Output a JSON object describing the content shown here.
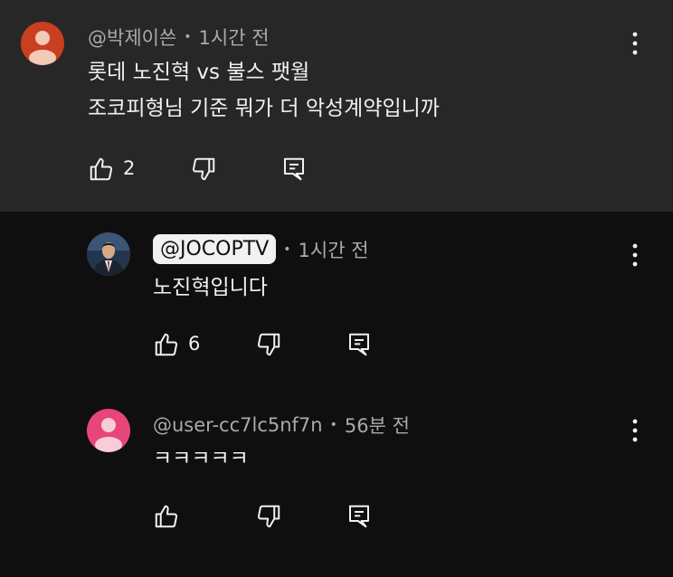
{
  "comments": [
    {
      "author": "@박제이쓴",
      "time": "1시간 전",
      "lines": [
        "롯데 노진혁 vs 불스 팻월",
        "조코피형님 기준 뭐가 더 악성계약입니까"
      ],
      "likes": "2"
    },
    {
      "author": "@JOCOPTV",
      "time": "1시간 전",
      "lines": [
        "노진혁입니다"
      ],
      "likes": "6"
    },
    {
      "author": "@user-cc7lc5nf7n",
      "time": "56분 전",
      "lines": [
        "ㅋㅋㅋㅋㅋ"
      ],
      "likes": ""
    }
  ],
  "separator": "•",
  "colors": {
    "top_background": "#272727",
    "page_background": "#0f0f0f",
    "avatar_orange": "#c8401f",
    "avatar_pink": "#e8467a"
  },
  "icons": [
    "like-icon",
    "dislike-icon",
    "reply-icon",
    "more-options-icon",
    "default-avatar-icon"
  ]
}
